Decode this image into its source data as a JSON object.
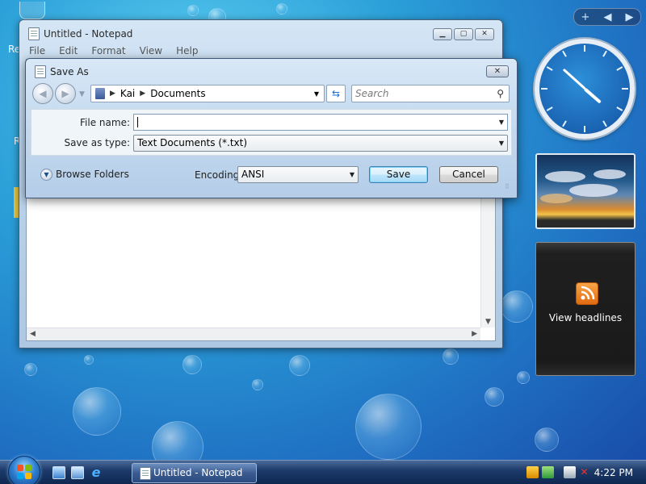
{
  "desktop": {
    "icon_label_recycle": "Re",
    "icon_label_r": "R"
  },
  "notepad": {
    "title": "Untitled - Notepad",
    "menu": [
      "File",
      "Edit",
      "Format",
      "View",
      "Help"
    ]
  },
  "save_as": {
    "title": "Save As",
    "breadcrumb": [
      "Kai",
      "Documents"
    ],
    "search_placeholder": "Search",
    "file_name_label": "File name:",
    "file_name_value": "",
    "save_as_type_label": "Save as type:",
    "save_as_type_value": "Text Documents (*.txt)",
    "browse_folders": "Browse Folders",
    "encoding_label": "Encoding:",
    "encoding_value": "ANSI",
    "save_button": "Save",
    "cancel_button": "Cancel"
  },
  "sidebar": {
    "add_gadget": "+",
    "feed_label": "View headlines",
    "clock_time": "4:22"
  },
  "taskbar": {
    "task_notepad": "Untitled - Notepad",
    "time": "4:22 PM"
  },
  "colors": {
    "desktop": "#1f6fc2",
    "accent": "#3c7fb1",
    "taskbar": "#0e2750"
  }
}
